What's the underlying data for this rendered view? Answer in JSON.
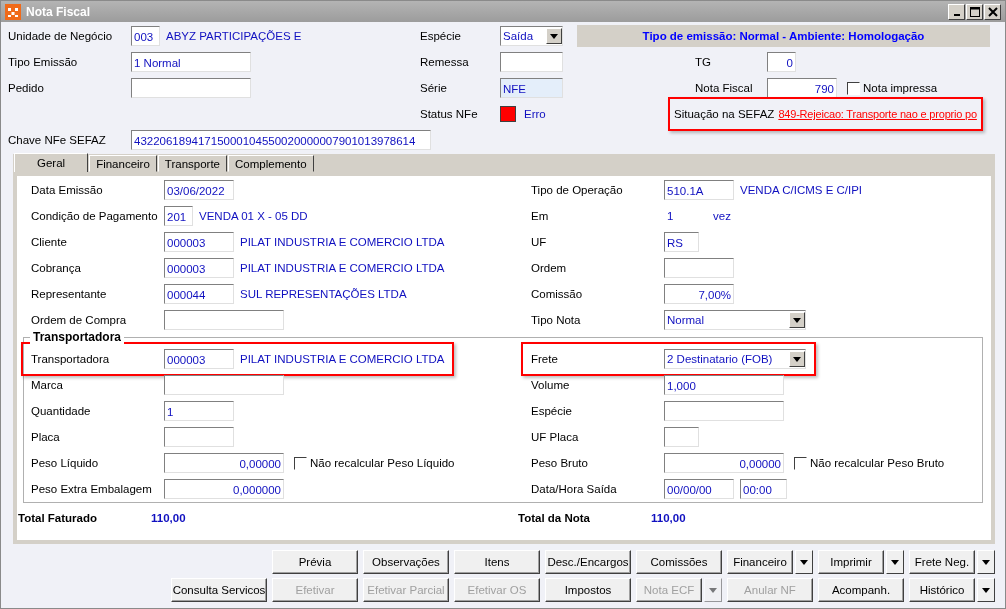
{
  "window": {
    "title": "Nota Fiscal"
  },
  "header": {
    "left": [
      {
        "label": "Unidade de Negócio",
        "items": [
          {
            "kind": "tiny",
            "value": "003"
          },
          {
            "kind": "text",
            "value": "ABYZ PARTICIPAÇÕES E"
          }
        ]
      },
      {
        "label": "Tipo Emissão",
        "items": [
          {
            "kind": "medium",
            "value": "1 Normal"
          }
        ]
      },
      {
        "label": "Pedido",
        "items": [
          {
            "kind": "medium"
          }
        ]
      }
    ],
    "middle": [
      {
        "label": "Espécie",
        "items": [
          {
            "kind": "select-short",
            "value": "Saída"
          }
        ]
      },
      {
        "label": "Remessa",
        "items": [
          {
            "kind": "mid"
          }
        ]
      },
      {
        "label": "Série",
        "items": [
          {
            "kind": "mid-locked",
            "value": "NFE"
          }
        ]
      },
      {
        "label": "Status NFe",
        "items": [
          {
            "kind": "status",
            "color": "#ff0000",
            "value": "Erro"
          }
        ]
      }
    ],
    "banner": "Tipo de emissão: Normal - Ambiente: Homologação",
    "right": [
      {
        "label": "TG",
        "highlighted": false,
        "items": [
          {
            "kind": "tiny-num",
            "value": "0"
          }
        ]
      },
      {
        "label": "Nota Fiscal",
        "highlighted": false,
        "items": [
          {
            "kind": "code-num",
            "value": "790"
          },
          {
            "kind": "checkbox",
            "label": "Nota impressa",
            "checked": false
          }
        ]
      },
      {
        "label": "Situação na SEFAZ",
        "highlighted": true,
        "items": [
          {
            "kind": "link",
            "value": "849-Rejeicao: Transporte nao e proprio po"
          }
        ]
      }
    ],
    "key": {
      "label": "Chave NFe SEFAZ",
      "items": [
        {
          "kind": "long",
          "value": "43220618941715000104550020000007901013978614"
        }
      ]
    }
  },
  "tabs": [
    {
      "label": "Geral",
      "selected": true
    },
    {
      "label": "Financeiro",
      "selected": false
    },
    {
      "label": "Transporte",
      "selected": false
    },
    {
      "label": "Complemento",
      "selected": false
    }
  ],
  "general": {
    "left": [
      {
        "label": "Data Emissão",
        "items": [
          {
            "kind": "code",
            "value": "03/06/2022"
          }
        ]
      },
      {
        "label": "Condição de Pagamento",
        "items": [
          {
            "kind": "tiny",
            "value": "201"
          },
          {
            "kind": "text",
            "value": "VENDA 01 X - 05 DD"
          }
        ]
      },
      {
        "label": "Cliente",
        "items": [
          {
            "kind": "code",
            "value": "000003"
          },
          {
            "kind": "text",
            "value": "PILAT INDUSTRIA E COMERCIO LTDA"
          }
        ]
      },
      {
        "label": "Cobrança",
        "items": [
          {
            "kind": "code",
            "value": "000003"
          },
          {
            "kind": "text",
            "value": "PILAT INDUSTRIA E COMERCIO LTDA"
          }
        ]
      },
      {
        "label": "Representante",
        "items": [
          {
            "kind": "code",
            "value": "000044"
          },
          {
            "kind": "text",
            "value": "SUL REPRESENTAÇÕES LTDA"
          }
        ]
      },
      {
        "label": "Ordem de Compra",
        "items": [
          {
            "kind": "medium"
          }
        ]
      }
    ],
    "right": [
      {
        "label": "Tipo de Operação",
        "items": [
          {
            "kind": "code",
            "value": "510.1A"
          },
          {
            "kind": "text",
            "value": "VENDA C/ICMS E C/IPI"
          }
        ]
      },
      {
        "label": "Em",
        "items": [
          {
            "kind": "plain",
            "value": "1"
          },
          {
            "kind": "text",
            "value": "vez"
          }
        ]
      },
      {
        "label": "UF",
        "items": [
          {
            "kind": "short",
            "value": "RS"
          }
        ]
      },
      {
        "label": "Ordem",
        "items": [
          {
            "kind": "code"
          }
        ]
      },
      {
        "label": "Comissão",
        "items": [
          {
            "kind": "code-num",
            "value": "7,00%"
          }
        ]
      },
      {
        "label": "Tipo Nota",
        "items": [
          {
            "kind": "select",
            "value": "Normal"
          }
        ]
      }
    ]
  },
  "transport": {
    "title": "Transportadora",
    "left": [
      {
        "label": "Transportadora",
        "highlighted": true,
        "items": [
          {
            "kind": "code",
            "value": "000003"
          },
          {
            "kind": "text",
            "value": "PILAT INDUSTRIA E COMERCIO LTDA"
          }
        ]
      },
      {
        "label": "Marca",
        "highlighted": false,
        "items": [
          {
            "kind": "medium"
          }
        ]
      },
      {
        "label": "Quantidade",
        "highlighted": false,
        "items": [
          {
            "kind": "code",
            "value": "1"
          }
        ]
      },
      {
        "label": "Placa",
        "highlighted": false,
        "items": [
          {
            "kind": "code"
          }
        ]
      },
      {
        "label": "Peso Líquido",
        "highlighted": false,
        "items": [
          {
            "kind": "medium-num",
            "value": "0,00000"
          },
          {
            "kind": "checkbox",
            "label": "Não recalcular Peso Líquido",
            "checked": false
          }
        ]
      },
      {
        "label": "Peso Extra Embalagem",
        "highlighted": false,
        "items": [
          {
            "kind": "medium-num",
            "value": "0,000000"
          }
        ]
      }
    ],
    "right": [
      {
        "label": "Frete",
        "highlighted": true,
        "items": [
          {
            "kind": "select",
            "value": "2 Destinatario (FOB)"
          }
        ]
      },
      {
        "label": "Volume",
        "highlighted": false,
        "items": [
          {
            "kind": "medium",
            "value": "1,000"
          }
        ]
      },
      {
        "label": "Espécie",
        "highlighted": false,
        "items": [
          {
            "kind": "medium"
          }
        ]
      },
      {
        "label": "UF Placa",
        "highlighted": false,
        "items": [
          {
            "kind": "short"
          }
        ]
      },
      {
        "label": "Peso Bruto",
        "highlighted": false,
        "items": [
          {
            "kind": "medium-num",
            "value": "0,00000"
          },
          {
            "kind": "checkbox",
            "label": "Não recalcular Peso Bruto",
            "checked": false
          }
        ]
      },
      {
        "label": "Data/Hora Saída",
        "highlighted": false,
        "items": [
          {
            "kind": "code",
            "value": "00/00/00"
          },
          {
            "kind": "time",
            "value": "00:00"
          }
        ]
      }
    ]
  },
  "totals": [
    {
      "label": "Total Faturado",
      "value": "110,00"
    },
    {
      "label": "Total da Nota",
      "value": "110,00"
    }
  ],
  "buttons": [
    [
      {
        "label": "Prévia",
        "disabled": false,
        "dropdown": false
      },
      {
        "label": "Observações",
        "disabled": false,
        "dropdown": false
      },
      {
        "label": "Itens",
        "disabled": false,
        "dropdown": false
      },
      {
        "label": "Desc./Encargos",
        "disabled": false,
        "dropdown": false
      },
      {
        "label": "Comissões",
        "disabled": false,
        "dropdown": false
      },
      {
        "label": "Financeiro",
        "disabled": false,
        "dropdown": true
      },
      {
        "label": "Imprimir",
        "disabled": false,
        "dropdown": true
      },
      {
        "label": "Frete Neg.",
        "disabled": false,
        "dropdown": true
      }
    ],
    [
      {
        "label": "Consulta Servicos",
        "disabled": false,
        "dropdown": false
      },
      {
        "label": "Efetivar",
        "disabled": true,
        "dropdown": false
      },
      {
        "label": "Efetivar Parcial",
        "disabled": true,
        "dropdown": false
      },
      {
        "label": "Efetivar OS",
        "disabled": true,
        "dropdown": false
      },
      {
        "label": "Impostos",
        "disabled": false,
        "dropdown": false
      },
      {
        "label": "Nota ECF",
        "disabled": true,
        "dropdown": true
      },
      {
        "label": "Anular NF",
        "disabled": true,
        "dropdown": false
      },
      {
        "label": "Acompanh.",
        "disabled": false,
        "dropdown": false
      },
      {
        "label": "Histórico",
        "disabled": false,
        "dropdown": true
      }
    ]
  ]
}
